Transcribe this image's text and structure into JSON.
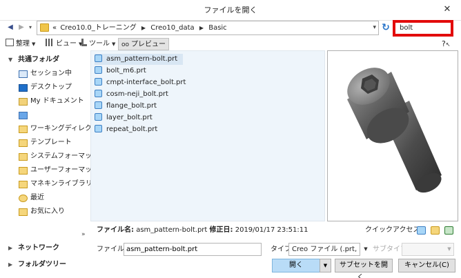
{
  "window": {
    "title": "ファイルを開く",
    "close_glyph": "✕"
  },
  "address": {
    "back": "◀",
    "forward": "▶",
    "dropdown": "▾",
    "crumbs": [
      "«",
      "Creo10.0_トレーニング",
      "Creo10_data",
      "Basic"
    ],
    "crumb_sep": "▶",
    "refresh": "↻",
    "search_value": "bolt"
  },
  "toolbar": {
    "organize": "整理",
    "view": "ビュー",
    "tools": "ツール",
    "preview": "プレビュー",
    "help": "?"
  },
  "leftnav": {
    "common_folders_caret": "▼",
    "common_folders": "共通フォルダ",
    "items": [
      {
        "label": "セッション中",
        "icon": "monitor-icon"
      },
      {
        "label": "デスクトップ",
        "icon": "desktop-icon"
      },
      {
        "label": "My ドキュメント",
        "icon": "documents-icon"
      },
      {
        "label": "",
        "icon": "computer-icon"
      },
      {
        "label": "ワーキングディレクトリ",
        "icon": "folder-icon"
      },
      {
        "label": "テンプレート",
        "icon": "folder-icon"
      },
      {
        "label": "システムフォーマット",
        "icon": "folder-icon"
      },
      {
        "label": "ユーザーフォーマット",
        "icon": "folder-icon"
      },
      {
        "label": "マネキンライブラリ",
        "icon": "folder-icon"
      },
      {
        "label": "最近",
        "icon": "recent-icon"
      },
      {
        "label": "お気に入り",
        "icon": "favorites-icon"
      }
    ],
    "collapse": "»",
    "network_caret": "▶",
    "network": "ネットワーク",
    "folder_tree_caret": "▶",
    "folder_tree": "フォルダツリー"
  },
  "files": [
    "asm_pattern-bolt.prt",
    "bolt_m6.prt",
    "cmpt-interface_bolt.prt",
    "cosm-neji_bolt.prt",
    "flange_bolt.prt",
    "layer_bolt.prt",
    "repeat_bolt.prt"
  ],
  "info": {
    "name_label": "ファイル名:",
    "name_value": "asm_pattern-bolt.prt",
    "date_label": "修正日:",
    "date_value": "2019/01/17 23:51:11",
    "quick_access": "クイックアクセス:"
  },
  "form": {
    "filename_label": "ファイル名:",
    "filename_value": "asm_pattern-bolt.prt",
    "type_label": "タイプ",
    "type_value": "Creo ファイル (.prt, .asm",
    "subtype_label": "サブタイプ",
    "caret": "▼"
  },
  "buttons": {
    "open": "開く",
    "open_drop": "▼",
    "open_subasm": "サブセットを開く...",
    "cancel": "キャンセル(C)"
  },
  "colors": {
    "search_highlight": "#e20b0b",
    "open_button": "#b9dcf7",
    "list_background": "#eef5fb",
    "selected_row": "#d8e6f3"
  }
}
